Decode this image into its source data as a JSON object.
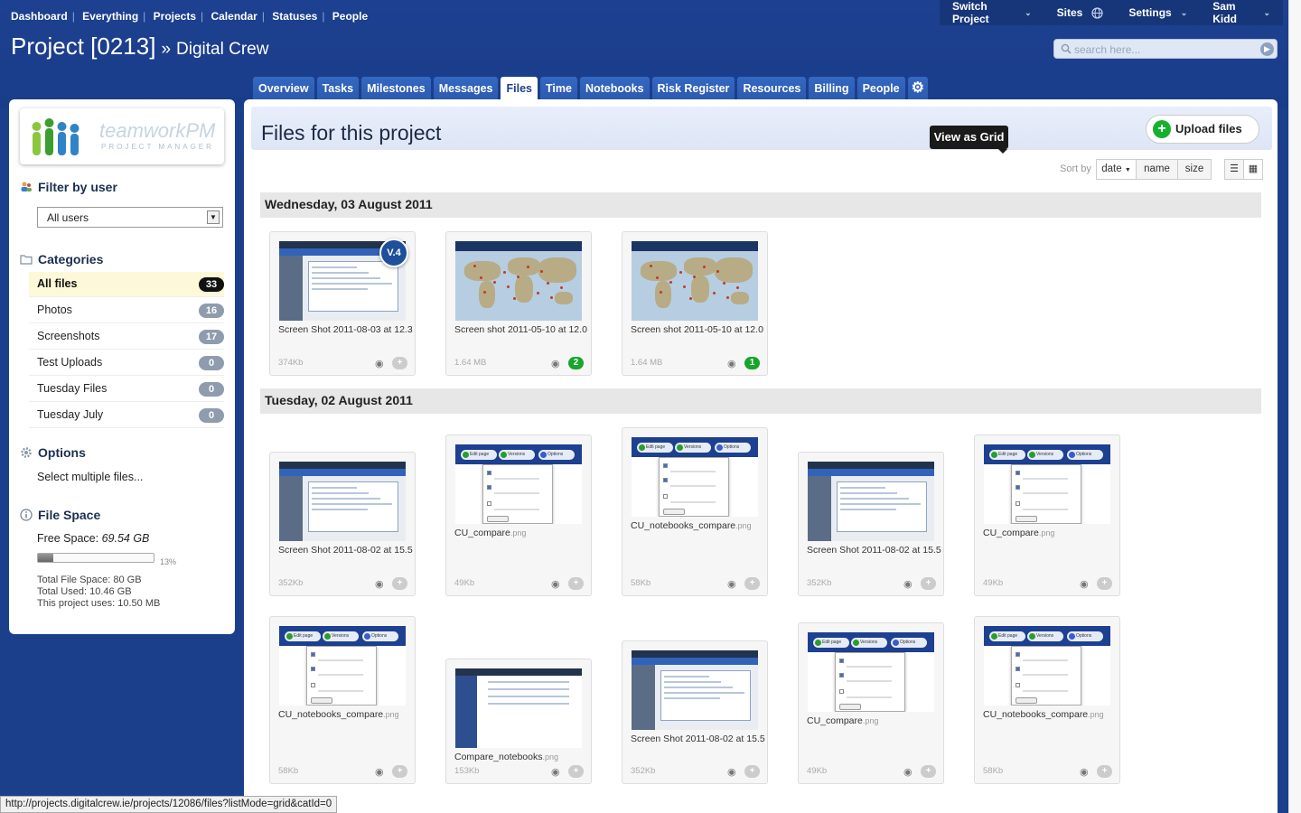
{
  "topnav": [
    "Dashboard",
    "Everything",
    "Projects",
    "Calendar",
    "Statuses",
    "People"
  ],
  "rightnav": {
    "switch_project": "Switch Project",
    "sites": "Sites",
    "settings": "Settings",
    "user": "Sam Kidd"
  },
  "header": {
    "project": "Project [0213]",
    "raquo": "»",
    "company": "Digital Crew"
  },
  "search": {
    "placeholder": "search here..."
  },
  "tabs": [
    "Overview",
    "Tasks",
    "Milestones",
    "Messages",
    "Files",
    "Time",
    "Notebooks",
    "Risk Register",
    "Resources",
    "Billing",
    "People"
  ],
  "active_tab": "Files",
  "sidebar": {
    "logo_text": "teamworkPM",
    "logo_sub": "PROJECT MANAGER",
    "filter_title": "Filter by user",
    "user_select": "All users",
    "categories_title": "Categories",
    "categories": [
      {
        "label": "All files",
        "count": "33"
      },
      {
        "label": "Photos",
        "count": "16"
      },
      {
        "label": "Screenshots",
        "count": "17"
      },
      {
        "label": "Test Uploads",
        "count": "0"
      },
      {
        "label": "Tuesday Files",
        "count": "0"
      },
      {
        "label": "Tuesday July",
        "count": "0"
      }
    ],
    "options_title": "Options",
    "select_multiple": "Select multiple files...",
    "filespace_title": "File Space",
    "free_space_label": "Free Space:",
    "free_space_value": "69.54 GB",
    "usage_pct_text": "13%",
    "usage_fraction": 0.13,
    "total_space": "Total File Space: 80 GB",
    "total_used": "Total Used: 10.46 GB",
    "project_uses": "This project uses: 10.50 MB"
  },
  "main": {
    "title": "Files for this project",
    "upload_label": "Upload files",
    "tooltip": "View as Grid",
    "sort_label": "Sort by",
    "sort_options": [
      "date",
      "name",
      "size"
    ],
    "sort_selected": "date",
    "days": [
      {
        "date": "Wednesday, 03 August 2011"
      },
      {
        "date": "Tuesday, 02 August 2011"
      }
    ],
    "files_day1": [
      {
        "name": "Screen Shot 2011-08-03 at 12.3",
        "ext": "",
        "size": "374Kb",
        "comments": "",
        "version": "V.4"
      },
      {
        "name": "Screen shot 2011-05-10 at 12.0",
        "ext": "",
        "size": "1.64 MB",
        "comments": "2"
      },
      {
        "name": "Screen shot 2011-05-10 at 12.0",
        "ext": "",
        "size": "1.64 MB",
        "comments": "1"
      }
    ],
    "files_day2": [
      {
        "name": "Screen Shot 2011-08-02 at 15.5",
        "ext": "",
        "size": "352Kb"
      },
      {
        "name": "CU_compare",
        "ext": ".png",
        "size": "49Kb"
      },
      {
        "name": "CU_notebooks_compare",
        "ext": ".png",
        "size": "58Kb"
      },
      {
        "name": "Screen Shot 2011-08-02 at 15.5",
        "ext": "",
        "size": "352Kb"
      },
      {
        "name": "CU_compare",
        "ext": ".png",
        "size": "49Kb"
      },
      {
        "name": "CU_notebooks_compare",
        "ext": ".png",
        "size": "58Kb"
      },
      {
        "name": "Compare_notebooks",
        "ext": ".png",
        "size": "153Kb"
      },
      {
        "name": "Screen Shot 2011-08-02 at 15.5",
        "ext": "",
        "size": "352Kb"
      },
      {
        "name": "CU_compare",
        "ext": ".png",
        "size": "49Kb"
      },
      {
        "name": "CU_notebooks_compare",
        "ext": ".png",
        "size": "58Kb"
      }
    ]
  },
  "statusbar": "http://projects.digitalcrew.ie/projects/12086/files?listMode=grid&catId=0",
  "colors": {
    "brand": "#1d4090",
    "green": "#17a62a"
  }
}
